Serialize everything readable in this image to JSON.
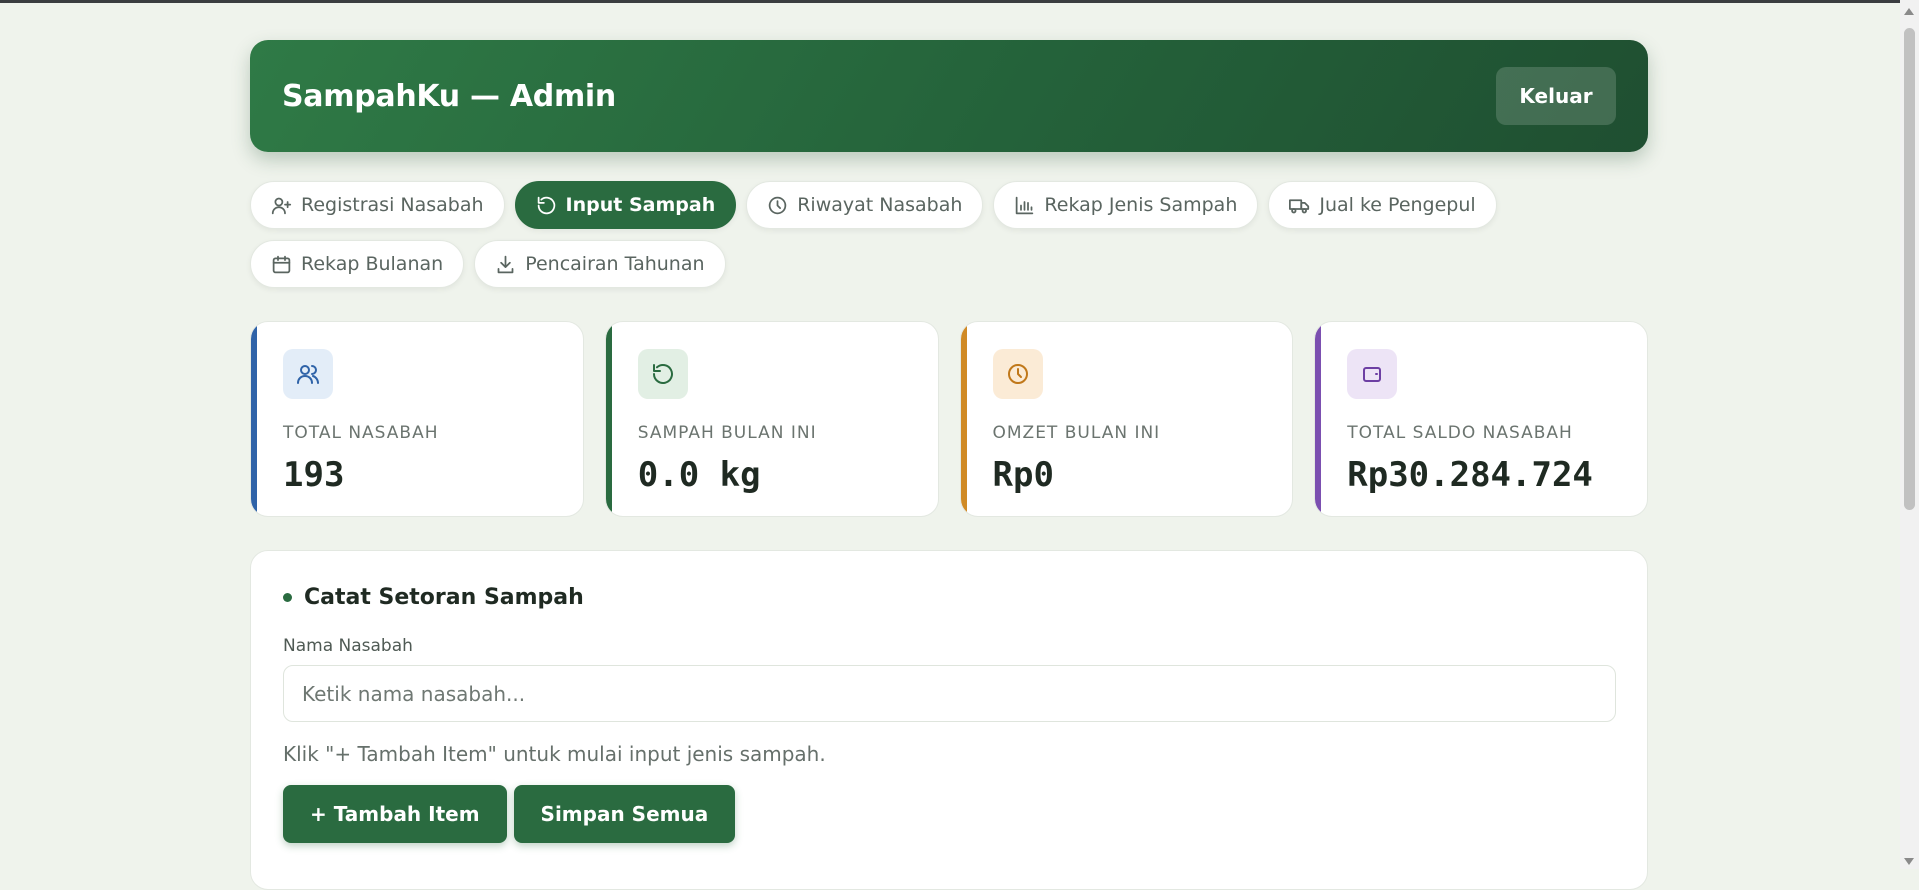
{
  "header": {
    "title": "SampahKu — Admin",
    "logout_label": "Keluar"
  },
  "nav": {
    "registrasi": "Registrasi Nasabah",
    "input": "Input Sampah",
    "riwayat": "Riwayat Nasabah",
    "rekap_jenis": "Rekap Jenis Sampah",
    "jual": "Jual ke Pengepul",
    "rekap_bulanan": "Rekap Bulanan",
    "pencairan": "Pencairan Tahunan"
  },
  "stats": [
    {
      "label": "TOTAL NASABAH",
      "value": "193",
      "color": "#2f63a8"
    },
    {
      "label": "SAMPAH BULAN INI",
      "value": "0.0 kg",
      "color": "#2a6b40"
    },
    {
      "label": "OMZET BULAN INI",
      "value": "Rp0",
      "color": "#d08a25"
    },
    {
      "label": "TOTAL SALDO NASABAH",
      "value": "Rp30.284.724",
      "color": "#7b4fb0"
    }
  ],
  "form": {
    "title": "Catat Setoran Sampah",
    "name_label": "Nama Nasabah",
    "name_placeholder": "Ketik nama nasabah...",
    "name_value": "",
    "hint": "Klik \"+ Tambah Item\" untuk mulai input jenis sampah.",
    "add_item_label": "+ Tambah Item",
    "save_all_label": "Simpan Semua"
  },
  "icons": {
    "registrasi": "user-plus-icon",
    "input": "rotate-icon",
    "riwayat": "clock-icon",
    "rekap_jenis": "bar-chart-icon",
    "jual": "truck-icon",
    "rekap_bulanan": "calendar-icon",
    "pencairan": "download-icon"
  }
}
